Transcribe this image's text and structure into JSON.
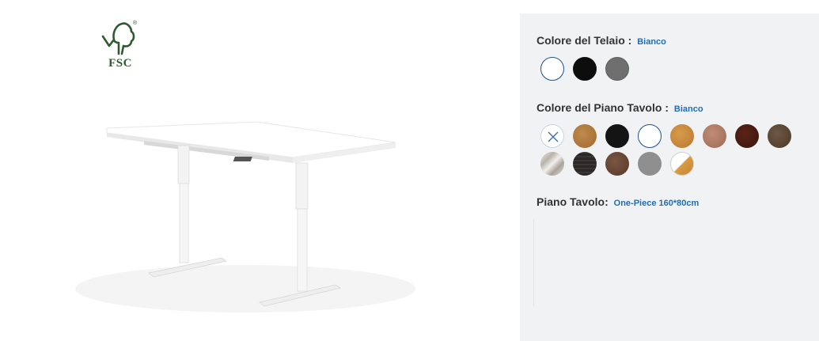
{
  "branding": {
    "fsc_logo_text": "FSC",
    "fsc_registered": "®",
    "fsc_icon": "tree-checkmark-icon"
  },
  "product": {
    "image_semantic": "height-adjustable-desk-white"
  },
  "options": {
    "frame": {
      "label": "Colore del Telaio :",
      "value": "Bianco",
      "swatches": [
        {
          "name": "Bianco",
          "color": "#ffffff",
          "selected": true
        },
        {
          "name": "Nero",
          "color": "#0d0d0d",
          "selected": false
        },
        {
          "name": "Grigio",
          "color": "#6f6f6f",
          "selected": false
        }
      ]
    },
    "top_color": {
      "label": "Colore del Piano Tavolo :",
      "value": "Bianco",
      "swatches": [
        {
          "name": "Nessuno",
          "color": "#ffffff",
          "icon": "x-icon",
          "selected": false
        },
        {
          "name": "Rovere",
          "color": "#b07a3e",
          "selected": false
        },
        {
          "name": "Nero",
          "color": "#141414",
          "selected": false
        },
        {
          "name": "Bianco",
          "color": "#ffffff",
          "selected": true
        },
        {
          "name": "Faggio",
          "color": "#c98a3c",
          "selected": false
        },
        {
          "name": "Ciliegio",
          "color": "#b07a62",
          "selected": false
        },
        {
          "name": "Mogano",
          "color": "#4a1d12",
          "selected": false
        },
        {
          "name": "Noce Scuro",
          "color": "#5e4a36",
          "selected": false
        },
        {
          "name": "Marmo",
          "color": "#d9d6d2",
          "selected": false
        },
        {
          "name": "Nero Legno",
          "color": "#2a2726",
          "selected": false
        },
        {
          "name": "Noce",
          "color": "#6a4636",
          "selected": false
        },
        {
          "name": "Grigio",
          "color": "#8f8f8f",
          "selected": false
        },
        {
          "name": "Bianco/Faggio",
          "color": "#d99a44",
          "selected": false
        }
      ]
    },
    "top_size": {
      "label": "Piano Tavolo:",
      "value": "One-Piece 160*80cm"
    }
  },
  "colors": {
    "accent": "#1c6fb8",
    "selected_ring": "#1d4f91",
    "panel_bg": "#f1f2f4",
    "fsc_green": "#2f5a31"
  }
}
